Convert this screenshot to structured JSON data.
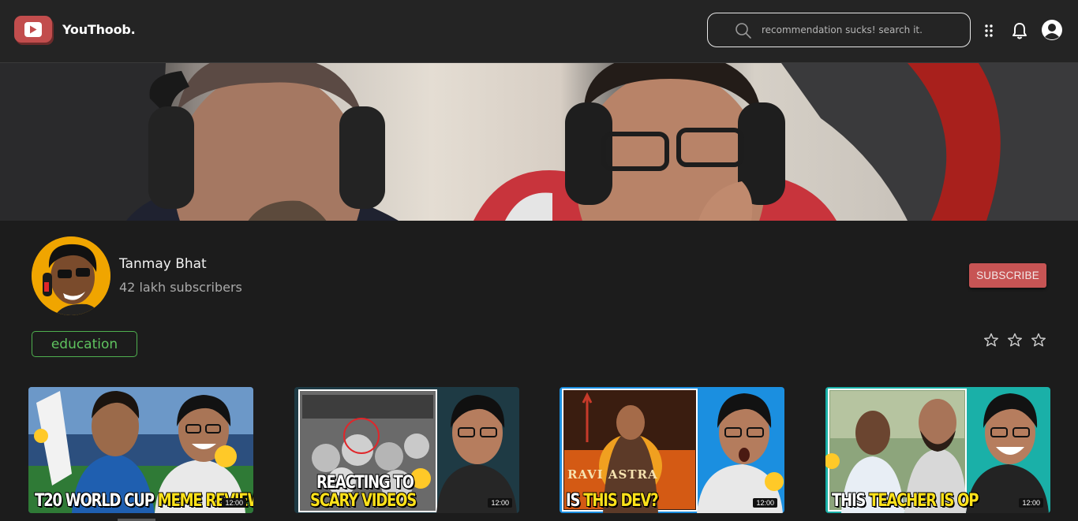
{
  "app": {
    "name": "YouThoob."
  },
  "search": {
    "placeholder": "recommendation sucks! search it."
  },
  "icons": {
    "logo": "play-icon",
    "search": "search-icon",
    "apps": "grid-dots-icon",
    "notifications": "bell-icon",
    "account": "user-circle-icon",
    "rating": "star-icon"
  },
  "channel": {
    "name": "Tanmay Bhat",
    "subscribers": "42 lakh subscribers",
    "tag": "education",
    "subscribe_label": "SUBSCRIBE",
    "rating_max": 3,
    "rating_value": 0
  },
  "colors": {
    "accent": "#c75454",
    "tag": "#4fb04f",
    "background": "#1c1c1c",
    "topbar": "#242424"
  },
  "videos": [
    {
      "title_white": "T20 WORLD CUP",
      "title_yellow": "MEME REVIEW",
      "duration": "12:00"
    },
    {
      "title_white": "REACTING TO",
      "title_yellow": "SCARY VIDEOS",
      "duration": "12:00"
    },
    {
      "title_white": "IS",
      "title_yellow": "THIS DEV?",
      "duration": "12:00",
      "poster_text": "RAVI ASTRA"
    },
    {
      "title_white": "THIS",
      "title_yellow": "TEACHER IS OP",
      "duration": "12:00"
    }
  ]
}
